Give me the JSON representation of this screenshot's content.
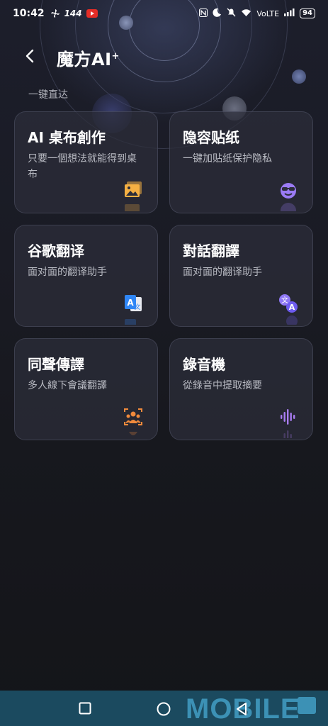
{
  "status_bar": {
    "time": "10:42",
    "refresh_rate": "144",
    "network": "VoLTE",
    "battery": "94"
  },
  "header": {
    "title": "魔方AI",
    "title_sup": "+"
  },
  "section_label": "一键直达",
  "cards": [
    {
      "title": "AI 桌布創作",
      "desc": "只要一個想法就能得到桌布",
      "icon": "image-icon",
      "color": "#f5b043"
    },
    {
      "title": "隐容贴纸",
      "desc": "一键加贴纸保护隐私",
      "icon": "sticker-face-icon",
      "color": "#9b7bf5"
    },
    {
      "title": "谷歌翻译",
      "desc": "面对面的翻译助手",
      "icon": "google-translate-icon",
      "color": "#2f86f6"
    },
    {
      "title": "對話翻譯",
      "desc": "面对面的翻译助手",
      "icon": "translate-icon",
      "color": "#8f78f5"
    },
    {
      "title": "同聲傳譯",
      "desc": "多人線下會議翻譯",
      "icon": "group-interpret-icon",
      "color": "#f08a3c"
    },
    {
      "title": "錄音機",
      "desc": "從錄音中提取摘要",
      "icon": "waveform-icon",
      "color": "#a87cf0"
    }
  ],
  "watermark": "MOBILE",
  "colors": {
    "background": "#16171c",
    "card": "#2c2e3a",
    "navbar": "#1b4a5f"
  }
}
